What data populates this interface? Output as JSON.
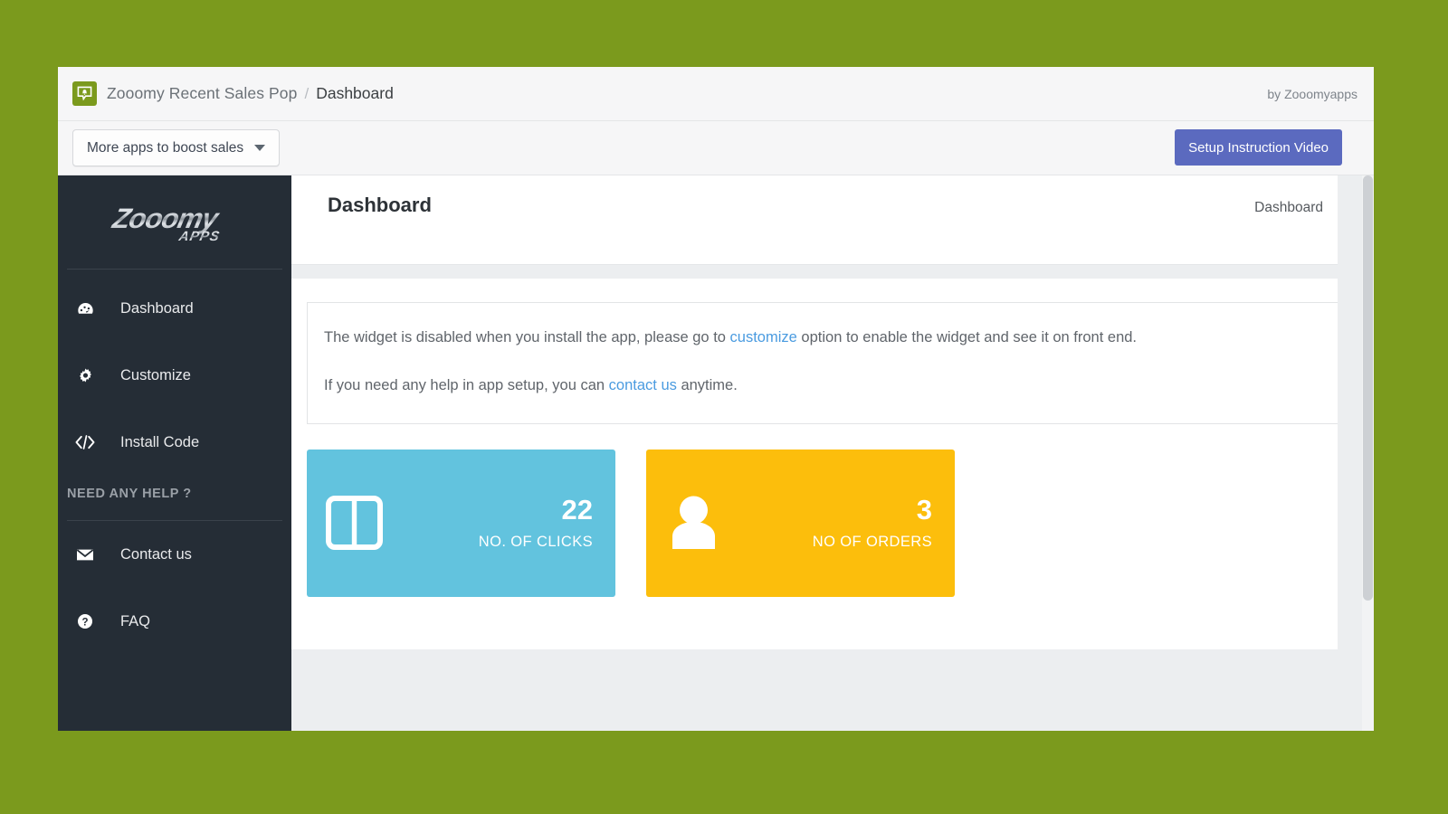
{
  "window": {
    "topbar": {
      "logo_icon": "speech-bubble-bell-icon",
      "app_title": "Zooomy Recent Sales Pop",
      "separator": "/",
      "current_crumb": "Dashboard",
      "byline": "by Zooomyapps",
      "brand_green": "#7b9a1d"
    },
    "actionbar": {
      "more_apps_label": "More apps to boost sales",
      "more_apps_caret_icon": "chevron-down-icon",
      "setup_video_label": "Setup Instruction Video",
      "setup_video_color": "#5b6abf"
    }
  },
  "sidebar": {
    "brand_text": "Zooomy",
    "brand_sub": "APPS",
    "background": "#252d36",
    "items": [
      {
        "label": "Dashboard",
        "icon": "gauge-dashboard-icon"
      },
      {
        "label": "Customize",
        "icon": "gear-icon"
      },
      {
        "label": "Install Code",
        "icon": "code-brackets-icon"
      }
    ],
    "help_section_title": "NEED ANY HELP ?",
    "help_items": [
      {
        "label": "Contact us",
        "icon": "envelope-icon"
      },
      {
        "label": "FAQ",
        "icon": "question-circle-icon"
      }
    ]
  },
  "page": {
    "title": "Dashboard",
    "breadcrumb": "Dashboard",
    "notice": {
      "line1_part1": "The widget is disabled when you install the app, please go to ",
      "line1_link": "customize",
      "line1_part2": " option to enable the widget and see it on front end.",
      "line2_part1": "If you need any help in app setup, you can ",
      "line2_link": "contact us",
      "line2_part2": " anytime.",
      "link_color": "#4a9be0"
    },
    "stats": [
      {
        "value": "22",
        "label": "NO. OF CLICKS",
        "icon": "columns-layout-icon",
        "color": "#62c3de"
      },
      {
        "value": "3",
        "label": "NO OF ORDERS",
        "icon": "user-person-icon",
        "color": "#fcbe0c"
      }
    ]
  },
  "page_background": "#7b9a1d"
}
